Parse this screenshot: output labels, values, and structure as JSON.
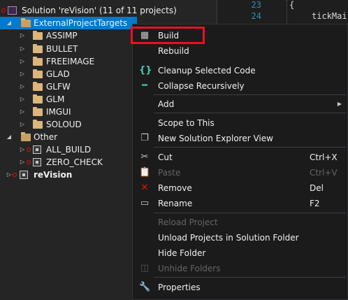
{
  "explorer": {
    "solution_label": "Solution 'reVision' (11 of 11 projects)",
    "selected_folder": "ExternalProjectTargets",
    "folders": [
      "ASSIMP",
      "BULLET",
      "FREEIMAGE",
      "GLAD",
      "GLFW",
      "GLM",
      "IMGUI",
      "SOLOUD"
    ],
    "other_folder": "Other",
    "other_projects": [
      "ALL_BUILD",
      "ZERO_CHECK"
    ],
    "main_project": "reVision"
  },
  "editor": {
    "line_numbers": [
      "23",
      "24"
    ],
    "lines": [
      "{",
      "tickMai"
    ]
  },
  "menu": {
    "build": "Build",
    "rebuild": "Rebuild",
    "cleanup": "Cleanup Selected Code",
    "collapse": "Collapse Recursively",
    "add": "Add",
    "scope": "Scope to This",
    "new_view": "New Solution Explorer View",
    "cut": "Cut",
    "cut_sc": "Ctrl+X",
    "paste": "Paste",
    "paste_sc": "Ctrl+V",
    "remove": "Remove",
    "remove_sc": "Del",
    "rename": "Rename",
    "rename_sc": "F2",
    "reload": "Reload Project",
    "unload": "Unload Projects in Solution Folder",
    "hide": "Hide Folder",
    "unhide": "Unhide Folders",
    "properties": "Properties"
  },
  "colors": {
    "selection": "#007acc",
    "highlight_box": "#e81123",
    "folder": "#dcb67a"
  }
}
